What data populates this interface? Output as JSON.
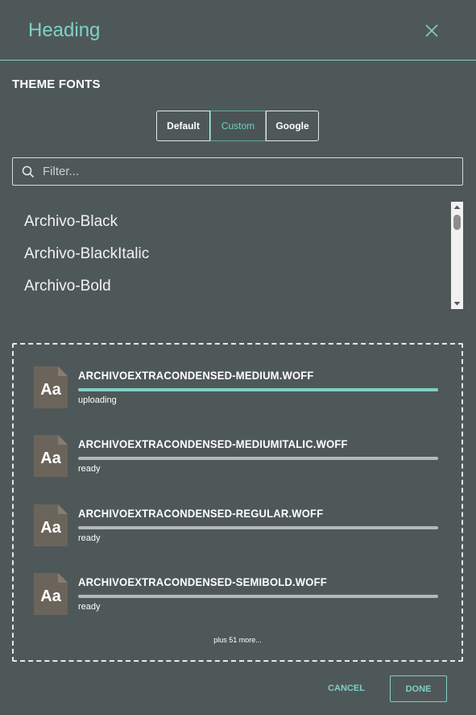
{
  "header": {
    "title": "Heading",
    "close_icon": "close-icon"
  },
  "theme_fonts": {
    "title": "THEME FONTS",
    "tabs": [
      {
        "label": "Default",
        "active": false
      },
      {
        "label": "Custom",
        "active": true
      },
      {
        "label": "Google",
        "active": false
      }
    ]
  },
  "filter": {
    "placeholder": "Filter...",
    "value": "",
    "icon": "search-icon"
  },
  "font_list": {
    "items": [
      "Archivo-Black",
      "Archivo-BlackItalic",
      "Archivo-Bold"
    ]
  },
  "uploads": {
    "files": [
      {
        "name": "ARCHIVOEXTRACONDENSED-MEDIUM.WOFF",
        "status": "uploading",
        "progress": 1.0
      },
      {
        "name": "ARCHIVOEXTRACONDENSED-MEDIUMITALIC.WOFF",
        "status": "ready",
        "progress": 0
      },
      {
        "name": "ARCHIVOEXTRACONDENSED-REGULAR.WOFF",
        "status": "ready",
        "progress": 0
      },
      {
        "name": "ARCHIVOEXTRACONDENSED-SEMIBOLD.WOFF",
        "status": "ready",
        "progress": 0
      }
    ],
    "file_icon_label": "Aa",
    "more_text": "plus 51 more..."
  },
  "footer": {
    "cancel_label": "CANCEL",
    "done_label": "DONE"
  },
  "colors": {
    "background": "#4f5859",
    "accent": "#7fcfc4",
    "file_icon": "#6b645b"
  }
}
